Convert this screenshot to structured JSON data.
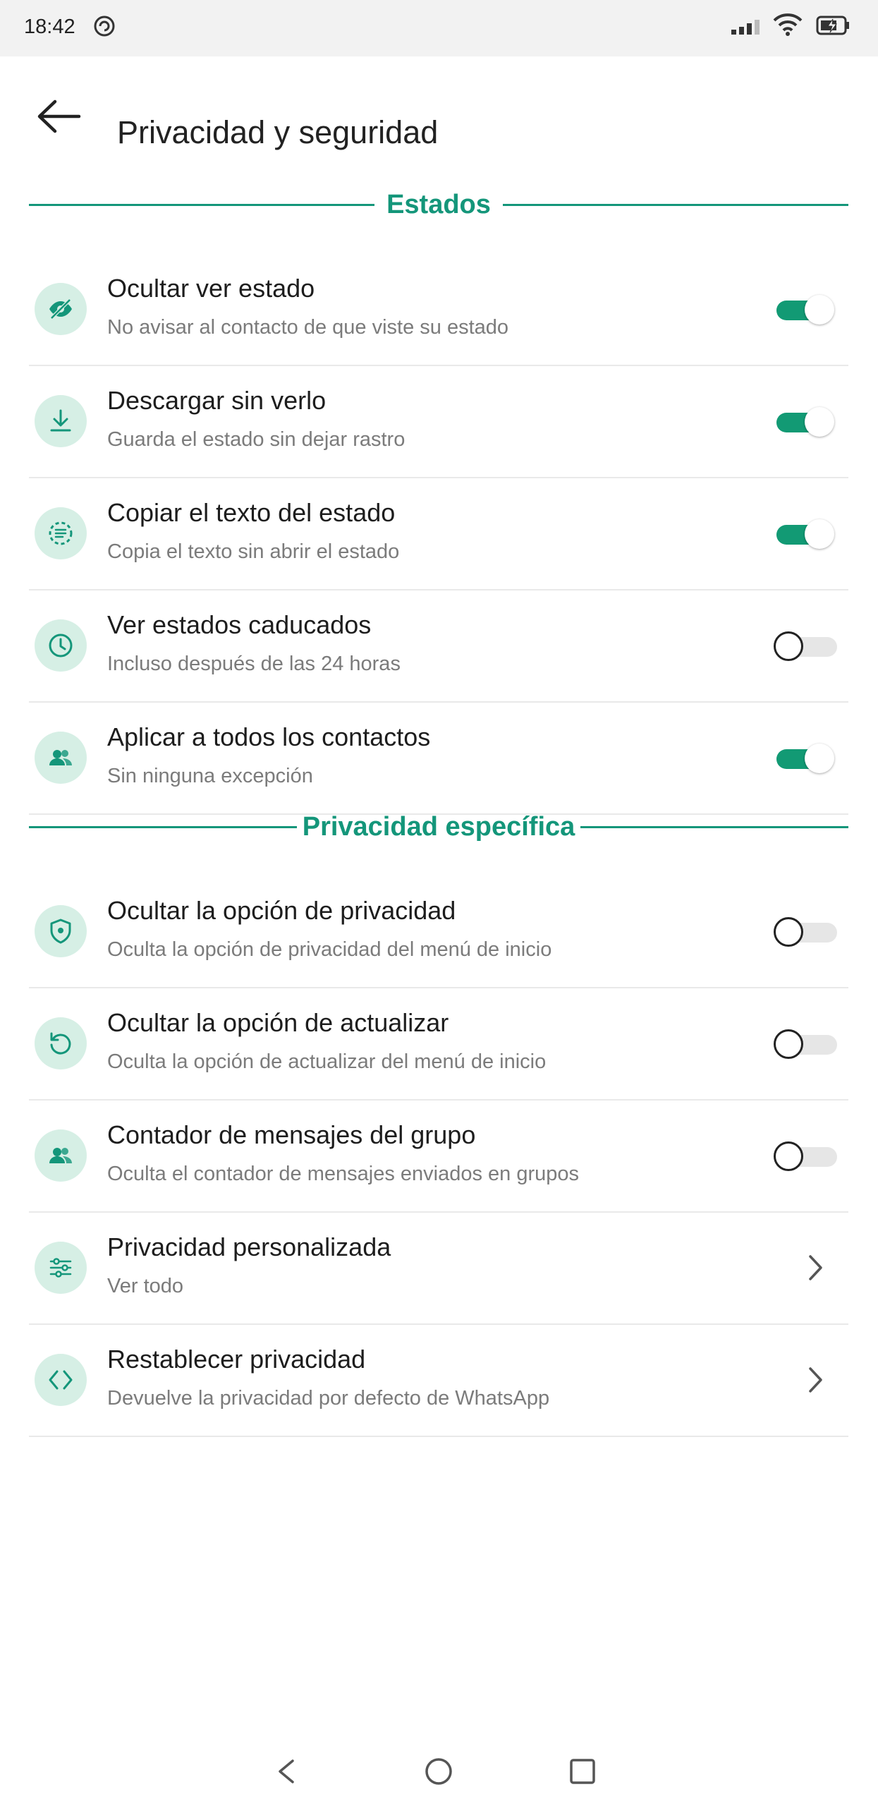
{
  "status_bar": {
    "time": "18:42",
    "icons": [
      "sync-icon",
      "signal-icon",
      "wifi-icon",
      "battery-charging-icon"
    ]
  },
  "header": {
    "title": "Privacidad y seguridad",
    "back_icon": "arrow-left-icon"
  },
  "sections": {
    "estados": {
      "label": "Estados",
      "items": [
        {
          "title": "Ocultar ver estado",
          "subtitle": "No avisar al contacto de que viste su estado",
          "icon": "eye-off-icon",
          "toggle": true
        },
        {
          "title": "Descargar sin verlo",
          "subtitle": "Guarda el estado sin dejar rastro",
          "icon": "download-icon",
          "toggle": true
        },
        {
          "title": "Copiar el texto del estado",
          "subtitle": "Copia el texto sin abrir el estado",
          "icon": "text-select-icon",
          "toggle": true
        },
        {
          "title": "Ver estados caducados",
          "subtitle": "Incluso después de las 24 horas",
          "icon": "clock-icon",
          "toggle": false
        },
        {
          "title": "Aplicar a todos los contactos",
          "subtitle": "Sin ninguna excepción",
          "icon": "contacts-icon",
          "toggle": true
        }
      ]
    },
    "privacidad": {
      "label": "Privacidad específica",
      "items": [
        {
          "title": "Ocultar la opción de privacidad",
          "subtitle": "Oculta la opción de privacidad del menú de inicio",
          "icon": "shield-icon",
          "toggle": false
        },
        {
          "title": "Ocultar la opción de actualizar",
          "subtitle": "Oculta la opción de actualizar del menú de inicio",
          "icon": "refresh-icon",
          "toggle": false
        },
        {
          "title": "Contador de mensajes del grupo",
          "subtitle": "Oculta el contador de mensajes enviados en grupos",
          "icon": "contacts-icon",
          "toggle": false
        },
        {
          "title": "Privacidad personalizada",
          "subtitle": "Ver todo",
          "icon": "sliders-icon",
          "chevron": true
        },
        {
          "title": "Restablecer privacidad",
          "subtitle": "Devuelve la privacidad por defecto de WhatsApp",
          "icon": "code-brackets-icon",
          "chevron": true
        }
      ]
    }
  },
  "nav_bar": {
    "icons": [
      "nav-back-icon",
      "nav-home-icon",
      "nav-recents-icon"
    ]
  },
  "colors": {
    "accent": "#14967a",
    "icon_bg": "#d6efe5",
    "toggle_on": "#129a74",
    "toggle_off_track": "#e6e6e6"
  }
}
